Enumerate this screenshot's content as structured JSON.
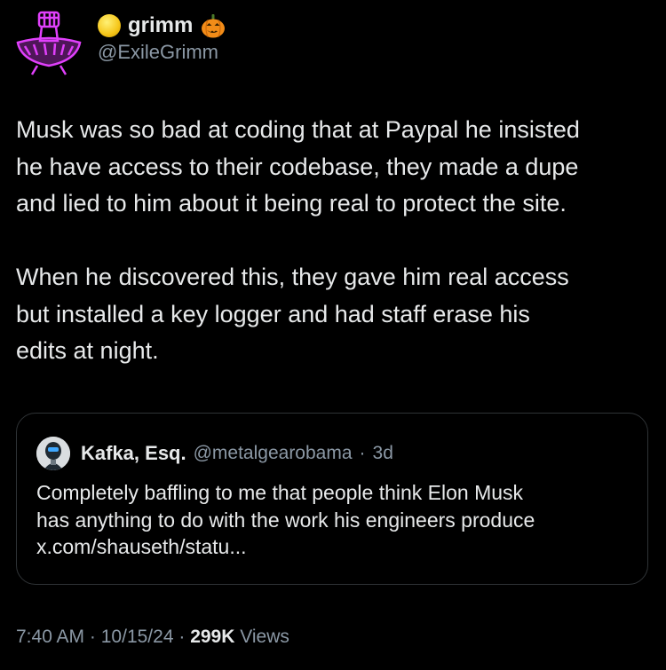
{
  "author": {
    "display_name": "grimm",
    "handle": "@ExileGrimm",
    "name_emojis": [
      "yellow-circle-icon",
      "jack-o-lantern-icon"
    ]
  },
  "tweet": {
    "text": "Musk was so bad at coding that at Paypal he insisted\nhe have access to their codebase, they made a dupe\nand lied to him about it being real to protect the site.\n\nWhen he discovered this, they gave him real access\nbut installed a key logger and had staff erase his\nedits at night."
  },
  "quoted_tweet": {
    "display_name": "Kafka, Esq.",
    "handle": "@metalgearobama",
    "separator": "·",
    "age": "3d",
    "text": "Completely baffling to me that people think Elon Musk\nhas anything to do with the work his engineers produce\nx.com/shauseth/statu..."
  },
  "meta": {
    "time": "7:40 AM",
    "date": "10/15/24",
    "separator": "·",
    "views_count": "299K",
    "views_label": "Views"
  },
  "colors": {
    "background": "#000000",
    "text": "#e7e9ea",
    "secondary": "#8b98a5",
    "border": "#2f3336",
    "avatar_accent": "#e040fb"
  }
}
